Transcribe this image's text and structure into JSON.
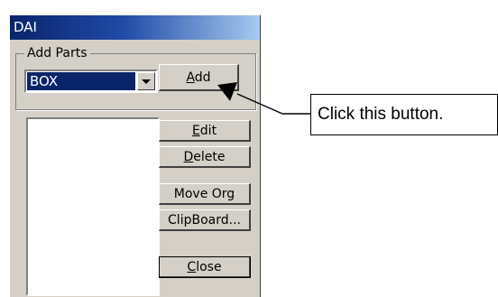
{
  "window": {
    "title": "DAI"
  },
  "add_parts": {
    "group_label": "Add Parts",
    "selected_part": "BOX",
    "add_button": {
      "accel": "A",
      "rest": "dd"
    }
  },
  "buttons": {
    "edit": {
      "accel": "E",
      "rest": "dit"
    },
    "delete": {
      "accel": "D",
      "rest": "elete"
    },
    "move_org": "Move Org",
    "clipboard": "ClipBoard...",
    "close": {
      "accel": "C",
      "rest": "lose"
    }
  },
  "annotation": {
    "text": "Click this button."
  },
  "icons": {
    "dropdown": "chevron-down-icon",
    "pointer": "arrow-pointer-icon"
  },
  "colors": {
    "titlebar": "#0a246a",
    "dialog_face": "#d4d0c8",
    "selection": "#0a246a"
  }
}
